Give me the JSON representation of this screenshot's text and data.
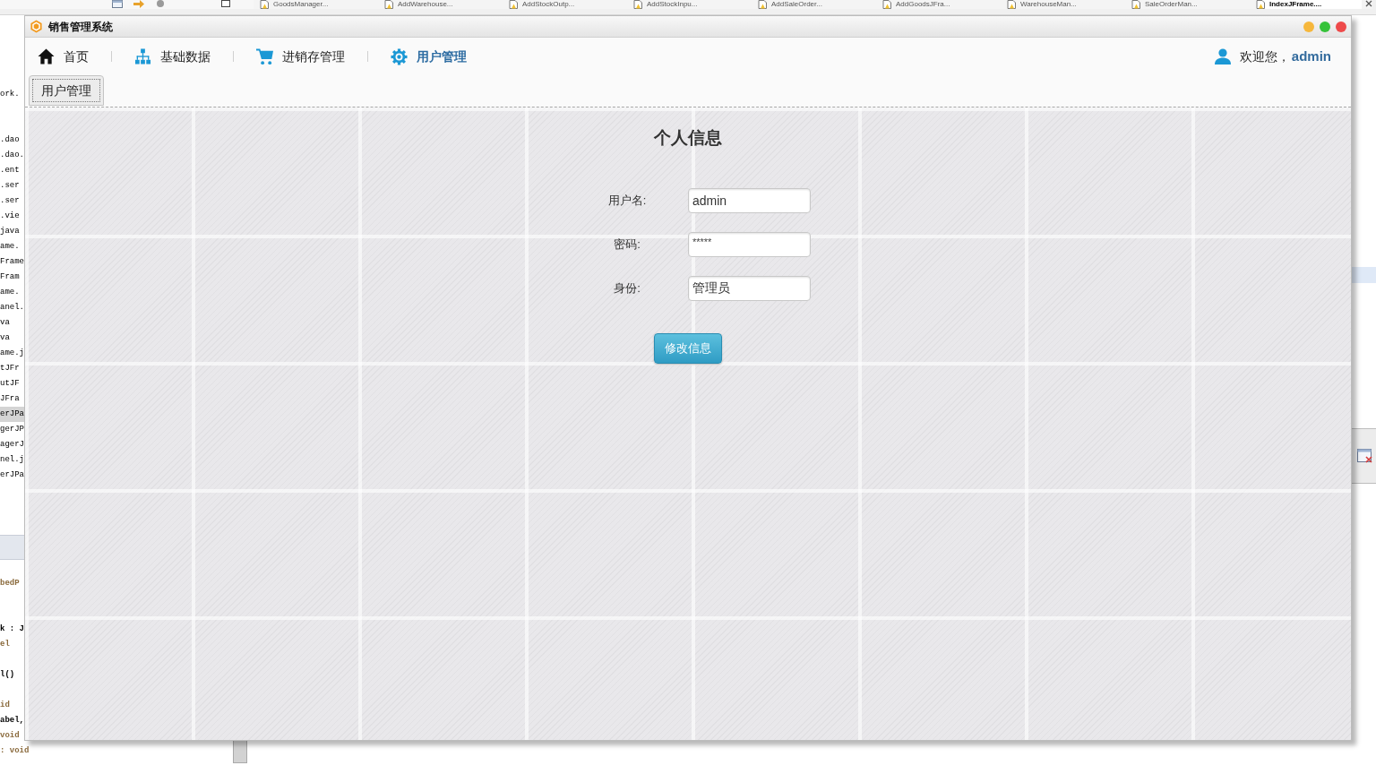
{
  "ide": {
    "editor_tabs": [
      {
        "label": "GoodsManager...",
        "selected": false
      },
      {
        "label": "AddWarehouse...",
        "selected": false
      },
      {
        "label": "AddStockOutp...",
        "selected": false
      },
      {
        "label": "AddStockInpu...",
        "selected": false
      },
      {
        "label": "AddSaleOrder...",
        "selected": false
      },
      {
        "label": "AddGoodsJFra...",
        "selected": false
      },
      {
        "label": "WarehouseMan...",
        "selected": false
      },
      {
        "label": "SaleOrderMan...",
        "selected": false
      },
      {
        "label": "IndexJFrame....",
        "selected": true
      }
    ],
    "explorer": {
      "header": "ork.",
      "items": [
        {
          "label": ".dao",
          "selected": false
        },
        {
          "label": ".dao.",
          "selected": false
        },
        {
          "label": ".ent",
          "selected": false
        },
        {
          "label": ".ser",
          "selected": false
        },
        {
          "label": ".ser",
          "selected": false
        },
        {
          "label": ".vie",
          "selected": false
        },
        {
          "label": "java",
          "selected": false
        },
        {
          "label": "ame.",
          "selected": false
        },
        {
          "label": "Frame",
          "selected": false
        },
        {
          "label": "Fram",
          "selected": false
        },
        {
          "label": "ame.",
          "selected": false
        },
        {
          "label": "anel.",
          "selected": false
        },
        {
          "label": "va",
          "selected": false
        },
        {
          "label": "va",
          "selected": false
        },
        {
          "label": "ame.j",
          "selected": false
        },
        {
          "label": "tJFr",
          "selected": false
        },
        {
          "label": "utJF",
          "selected": false
        },
        {
          "label": "JFra",
          "selected": false
        },
        {
          "label": "erJPa",
          "selected": true
        },
        {
          "label": "gerJP",
          "selected": false
        },
        {
          "label": "agerJ",
          "selected": false
        },
        {
          "label": "nel.j",
          "selected": false
        },
        {
          "label": "erJPa",
          "selected": false
        }
      ]
    },
    "editor_lines": [
      {
        "text": "bedP",
        "kind": "keyword"
      },
      {
        "text": "k : J",
        "kind": "plain"
      },
      {
        "text": "el",
        "kind": "keyword"
      },
      {
        "text": "l()",
        "kind": "plain"
      },
      {
        "text": "id",
        "kind": "keyword"
      },
      {
        "text": "abel,",
        "kind": "plain"
      },
      {
        "text": "void",
        "kind": "keyword"
      },
      {
        "text": ": void",
        "kind": "keyword"
      }
    ]
  },
  "window": {
    "title": "销售管理系统"
  },
  "nav": {
    "items": [
      {
        "label": "首页",
        "selected": false
      },
      {
        "label": "基础数据",
        "selected": false
      },
      {
        "label": "进销存管理",
        "selected": false
      },
      {
        "label": "用户管理",
        "selected": true
      }
    ],
    "welcome": "欢迎您，",
    "username": "admin"
  },
  "tabs": [
    {
      "label": "用户管理",
      "selected": true
    }
  ],
  "form": {
    "title": "个人信息",
    "fields": [
      {
        "label": "用户名:",
        "value": "admin",
        "kind": "text"
      },
      {
        "label": "密码:",
        "value": "*****",
        "kind": "password"
      },
      {
        "label": "身份:",
        "value": "管理员",
        "kind": "text"
      }
    ],
    "submit": "修改信息"
  }
}
